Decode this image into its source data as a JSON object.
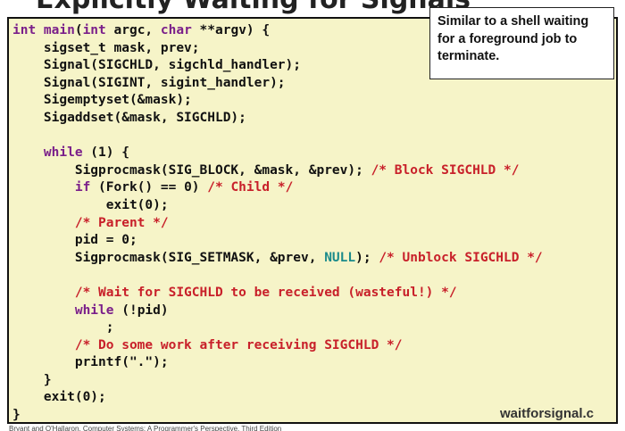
{
  "slide_title": "Explicitly Waiting for Signals",
  "code": {
    "l1": {
      "a": "int ",
      "b": "main",
      "c": "(",
      "d": "int",
      "e": " argc, ",
      "f": "char",
      "g": " **argv) {"
    },
    "l2": "    sigset_t mask, prev;",
    "l3": "    Signal(SIGCHLD, sigchld_handler);",
    "l4": "    Signal(SIGINT, sigint_handler);",
    "l5": "    Sigemptyset(&mask);",
    "l6": "    Sigaddset(&mask, SIGCHLD);",
    "l7": "",
    "l8": {
      "kw": "    while",
      "rest": " (1) {"
    },
    "l9": {
      "code": "        Sigprocmask(SIG_BLOCK, &mask, &prev); ",
      "comment": "/* Block SIGCHLD */"
    },
    "l10": {
      "kw": "        if",
      "code": " (Fork() == 0) ",
      "comment": "/* Child */"
    },
    "l11": "            exit(0);",
    "l12": {
      "comment": "        /* Parent */"
    },
    "l13": "        pid = 0;",
    "l14": {
      "a": "        Sigprocmask(SIG_SETMASK, &prev, ",
      "const": "NULL",
      "b": "); ",
      "comment": "/* Unblock SIGCHLD */"
    },
    "l15": "",
    "l16": {
      "comment": "        /* Wait for SIGCHLD to be received (wasteful!) */"
    },
    "l17": {
      "kw": "        while",
      "rest": " (!pid)"
    },
    "l18": "            ;",
    "l19": {
      "comment": "        /* Do some work after receiving SIGCHLD */"
    },
    "l20": "        printf(\".\");",
    "l21": "    }",
    "l22": "    exit(0);",
    "l23": "}"
  },
  "callout": {
    "line1": "Similar to a shell waiting",
    "line2": "for a foreground job to",
    "line3": "terminate."
  },
  "watermark": "waitforsignal.c",
  "footer": "Bryant and O'Hallaron, Computer Systems: A Programmer's Perspective, Third Edition",
  "colors": {
    "background": "#f6f4c8",
    "keyword": "#7a1f8a",
    "comment": "#c8202a",
    "constant": "#1a8a8a"
  }
}
